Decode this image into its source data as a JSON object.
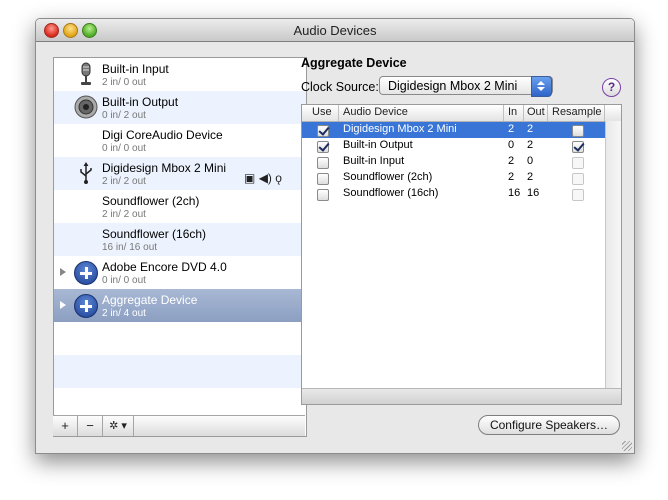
{
  "window": {
    "title": "Audio Devices"
  },
  "devices": [
    {
      "name": "Built-in Input",
      "sub": "2 in/ 0 out",
      "icon": "microphone-icon"
    },
    {
      "name": "Built-in Output",
      "sub": "0 in/ 2 out",
      "icon": "speaker-icon"
    },
    {
      "name": "Digi CoreAudio Device",
      "sub": "0 in/ 0 out",
      "icon": "none"
    },
    {
      "name": "Digidesign Mbox 2 Mini",
      "sub": "2 in/ 2 out",
      "icon": "usb-icon"
    },
    {
      "name": "Soundflower (2ch)",
      "sub": "2 in/ 2 out",
      "icon": "none"
    },
    {
      "name": "Soundflower (16ch)",
      "sub": "16 in/ 16 out",
      "icon": "none"
    },
    {
      "name": "Adobe Encore DVD 4.0",
      "sub": "0 in/ 0 out",
      "icon": "aggregate-icon"
    },
    {
      "name": "Aggregate Device",
      "sub": "2 in/ 4 out",
      "icon": "aggregate-icon"
    }
  ],
  "list_toolbar": {
    "add": "+",
    "remove": "−",
    "action": "✲ ▾"
  },
  "aggregate": {
    "title": "Aggregate Device",
    "clock_label": "Clock Source:",
    "clock_value": "Digidesign Mbox 2 Mini",
    "help": "?",
    "columns": {
      "use": "Use",
      "device": "Audio Device",
      "in": "In",
      "out": "Out",
      "resample": "Resample"
    },
    "rows": [
      {
        "use": true,
        "device": "Digidesign Mbox 2 Mini",
        "in": "2",
        "out": "2",
        "resample": false,
        "resample_enabled": true
      },
      {
        "use": true,
        "device": "Built-in Output",
        "in": "0",
        "out": "2",
        "resample": true,
        "resample_enabled": true
      },
      {
        "use": false,
        "device": "Built-in Input",
        "in": "2",
        "out": "0",
        "resample": false,
        "resample_enabled": false
      },
      {
        "use": false,
        "device": "Soundflower (2ch)",
        "in": "2",
        "out": "2",
        "resample": false,
        "resample_enabled": false
      },
      {
        "use": false,
        "device": "Soundflower (16ch)",
        "in": "16",
        "out": "16",
        "resample": false,
        "resample_enabled": false
      }
    ]
  },
  "configure_button": "Configure Speakers…",
  "colors": {
    "selection": "#3875d7",
    "list_selection": "#8c9fc2",
    "alt_row": "#edf3fe"
  }
}
